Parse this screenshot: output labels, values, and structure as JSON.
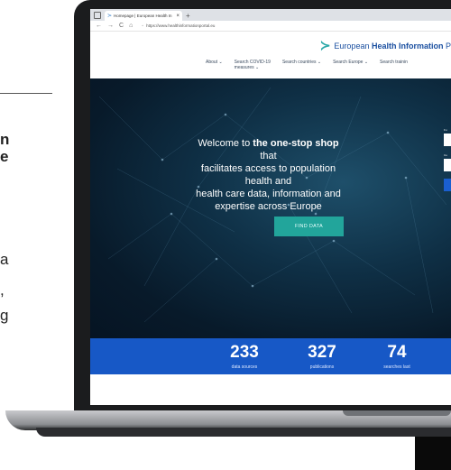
{
  "left_text": {
    "frag1": "n",
    "frag2": "e",
    "frag3": "a",
    "frag4": ",",
    "frag5": "g"
  },
  "browser": {
    "tab_title": "Homepage | European Health In",
    "tab_close": "×",
    "new_tab": "+",
    "back": "←",
    "forward": "→",
    "reload": "C",
    "home": "⌂",
    "url": "https://www.healthinformationportal.eu"
  },
  "site": {
    "logo_prefix": "European ",
    "logo_bold": "Health Information",
    "logo_suffix": " P",
    "nav": [
      {
        "label": "About",
        "caret": "⌄"
      },
      {
        "label": "Search COVID-19",
        "label2": "measures",
        "caret": "⌄"
      },
      {
        "label": "Search countries",
        "caret": "⌄"
      },
      {
        "label": "Search Europe",
        "caret": "⌄"
      },
      {
        "label": "Search trainin"
      }
    ]
  },
  "hero": {
    "line1_pre": "Welcome to ",
    "line1_bold": "the one-stop shop",
    "line1_post": " that",
    "line2": "facilitates access to population health and",
    "line3": "health care data, information and",
    "line4": "expertise across Europe",
    "button": "FIND DATA",
    "side_label1": "Fu",
    "side_label2": "Co"
  },
  "stats": [
    {
      "value": "233",
      "label": "data sources"
    },
    {
      "value": "327",
      "label": "publications"
    },
    {
      "value": "74",
      "label": "searches last"
    }
  ],
  "colors": {
    "accent_teal": "#22a59b",
    "brand_blue": "#1a4fa0",
    "stats_blue": "#1758c6"
  }
}
